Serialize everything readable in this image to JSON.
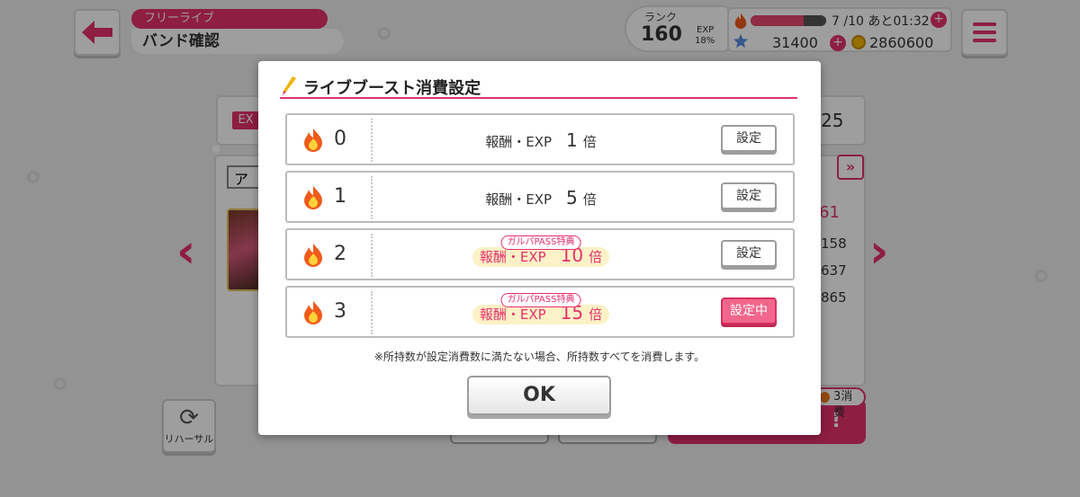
{
  "header": {
    "mode_label": "フリーライブ",
    "page_title": "バンド確認"
  },
  "status": {
    "rank_label": "ランク",
    "rank_value": "160",
    "exp_label": "EXP",
    "exp_value": "18%",
    "stamina_text": "7 /10 あと01:32",
    "stamina_fraction": 0.7,
    "stars": "31400",
    "coins": "2860600",
    "plus": "+"
  },
  "background": {
    "ex_tag": "EX",
    "value_a": "25",
    "tab_label": "ア",
    "value_b": "61",
    "value_c": "158",
    "value_d": "637",
    "value_e": "865",
    "next_label": "»",
    "rehearsal_label": "リハーサル",
    "live_start_label": "!",
    "cost_label": "3消費"
  },
  "modal": {
    "title": "ライブブースト消費設定",
    "reward_prefix": "報酬・EXP",
    "multiplier_suffix": "倍",
    "pass_tag": "ガルパPASS特典",
    "options": [
      {
        "count": "0",
        "multiplier": "1",
        "button": "設定"
      },
      {
        "count": "1",
        "multiplier": "5",
        "button": "設定"
      },
      {
        "count": "2",
        "multiplier": "10",
        "button": "設定"
      },
      {
        "count": "3",
        "multiplier": "15",
        "button": "設定中"
      }
    ],
    "notice": "※所持数が設定消費数に満たない場合、所持数すべてを消費します。",
    "ok_label": "OK"
  },
  "colors": {
    "accent": "#e5316b",
    "active_button": "#f2668c",
    "pass_highlight": "#fdf1c7"
  },
  "icons": [
    "back-arrow-icon",
    "menu-icon",
    "flame-icon",
    "star-icon",
    "coin-icon",
    "pen-icon",
    "rehearsal-icon"
  ]
}
